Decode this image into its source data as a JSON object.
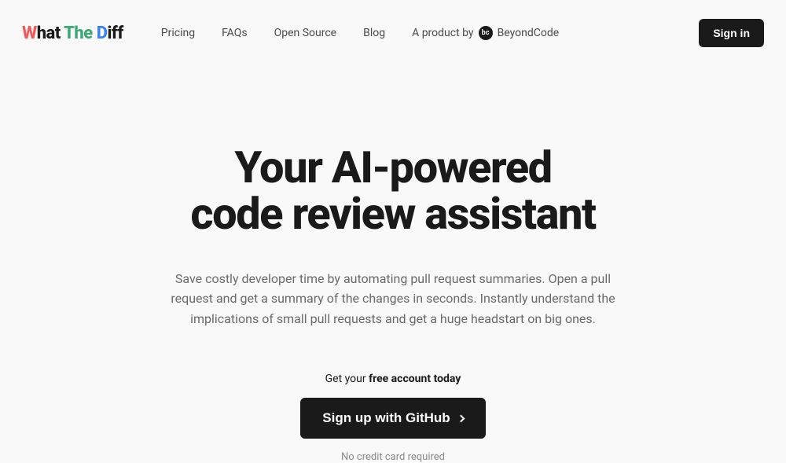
{
  "logo": {
    "w": "W",
    "hat": "hat",
    "the": " The ",
    "d": "D",
    "iff": "iff"
  },
  "nav": {
    "pricing": "Pricing",
    "faqs": "FAQs",
    "open_source": "Open Source",
    "blog": "Blog",
    "product_by": "A product by",
    "beyondcode": "BeyondCode"
  },
  "signin": "Sign in",
  "hero": {
    "title_line1": "Your AI-powered",
    "title_line2": "code review assistant",
    "subtitle": "Save costly developer time by automating pull request summaries. Open a pull request and get a summary of the changes in seconds. Instantly understand the implications of small pull requests and get a huge headstart on big ones."
  },
  "cta": {
    "prompt_prefix": "Get your ",
    "prompt_bold": "free account today",
    "button": "Sign up with GitHub",
    "no_card": "No credit card required"
  }
}
